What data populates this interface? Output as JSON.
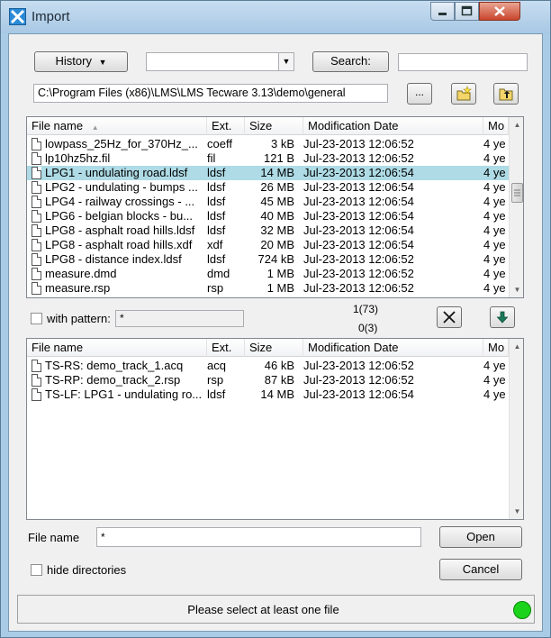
{
  "window": {
    "title": "Import",
    "minimize_icon": "minimize-icon",
    "maximize_icon": "maximize-icon",
    "close_icon": "close-icon"
  },
  "toolbar": {
    "history_label": "History",
    "combo_value": "",
    "search_label": "Search:",
    "search_value": "",
    "path": "C:\\Program Files (x86)\\LMS\\LMS Tecware 3.13\\demo\\general",
    "browse_label": "..."
  },
  "top_list": {
    "columns": [
      "File name",
      "Ext.",
      "Size",
      "Modification Date",
      "Mo"
    ],
    "rows": [
      {
        "name": "lowpass_25Hz_for_370Hz_...",
        "ext": "coeff",
        "size": "3 kB",
        "date": "Jul-23-2013 12:06:52",
        "mod": "4 ye",
        "selected": false
      },
      {
        "name": "lp10hz5hz.fil",
        "ext": "fil",
        "size": "121 B",
        "date": "Jul-23-2013 12:06:52",
        "mod": "4 ye",
        "selected": false
      },
      {
        "name": "LPG1 - undulating road.ldsf",
        "ext": "ldsf",
        "size": "14 MB",
        "date": "Jul-23-2013 12:06:54",
        "mod": "4 ye",
        "selected": true
      },
      {
        "name": "LPG2 - undulating - bumps ...",
        "ext": "ldsf",
        "size": "26 MB",
        "date": "Jul-23-2013 12:06:54",
        "mod": "4 ye",
        "selected": false
      },
      {
        "name": "LPG4 - railway crossings - ...",
        "ext": "ldsf",
        "size": "45 MB",
        "date": "Jul-23-2013 12:06:54",
        "mod": "4 ye",
        "selected": false
      },
      {
        "name": "LPG6 - belgian blocks - bu...",
        "ext": "ldsf",
        "size": "40 MB",
        "date": "Jul-23-2013 12:06:54",
        "mod": "4 ye",
        "selected": false
      },
      {
        "name": "LPG8 - asphalt road hills.ldsf",
        "ext": "ldsf",
        "size": "32 MB",
        "date": "Jul-23-2013 12:06:54",
        "mod": "4 ye",
        "selected": false
      },
      {
        "name": "LPG8 - asphalt road hills.xdf",
        "ext": "xdf",
        "size": "20 MB",
        "date": "Jul-23-2013 12:06:54",
        "mod": "4 ye",
        "selected": false
      },
      {
        "name": "LPG8 - distance index.ldsf",
        "ext": "ldsf",
        "size": "724 kB",
        "date": "Jul-23-2013 12:06:52",
        "mod": "4 ye",
        "selected": false
      },
      {
        "name": "measure.dmd",
        "ext": "dmd",
        "size": "1 MB",
        "date": "Jul-23-2013 12:06:52",
        "mod": "4 ye",
        "selected": false
      },
      {
        "name": "measure.rsp",
        "ext": "rsp",
        "size": "1 MB",
        "date": "Jul-23-2013 12:06:52",
        "mod": "4 ye",
        "selected": false
      }
    ]
  },
  "filter": {
    "with_pattern_label": "with pattern:",
    "pattern_value": "*",
    "count_top": "1(73)",
    "count_bottom": "0(3)"
  },
  "bottom_list": {
    "columns": [
      "File name",
      "Ext.",
      "Size",
      "Modification Date",
      "Mo"
    ],
    "rows": [
      {
        "name": "TS-RS: demo_track_1.acq",
        "ext": "acq",
        "size": "46 kB",
        "date": "Jul-23-2013 12:06:52",
        "mod": "4 ye"
      },
      {
        "name": "TS-RP: demo_track_2.rsp",
        "ext": "rsp",
        "size": "87 kB",
        "date": "Jul-23-2013 12:06:52",
        "mod": "4 ye"
      },
      {
        "name": "TS-LF: LPG1 - undulating ro...",
        "ext": "ldsf",
        "size": "14 MB",
        "date": "Jul-23-2013 12:06:54",
        "mod": "4 ye"
      }
    ]
  },
  "footer": {
    "file_name_label": "File name",
    "file_name_value": "*",
    "open_label": "Open",
    "hide_dirs_label": "hide directories",
    "cancel_label": "Cancel",
    "status_text": "Please select at least one file",
    "status_color": "#1bd31b"
  }
}
